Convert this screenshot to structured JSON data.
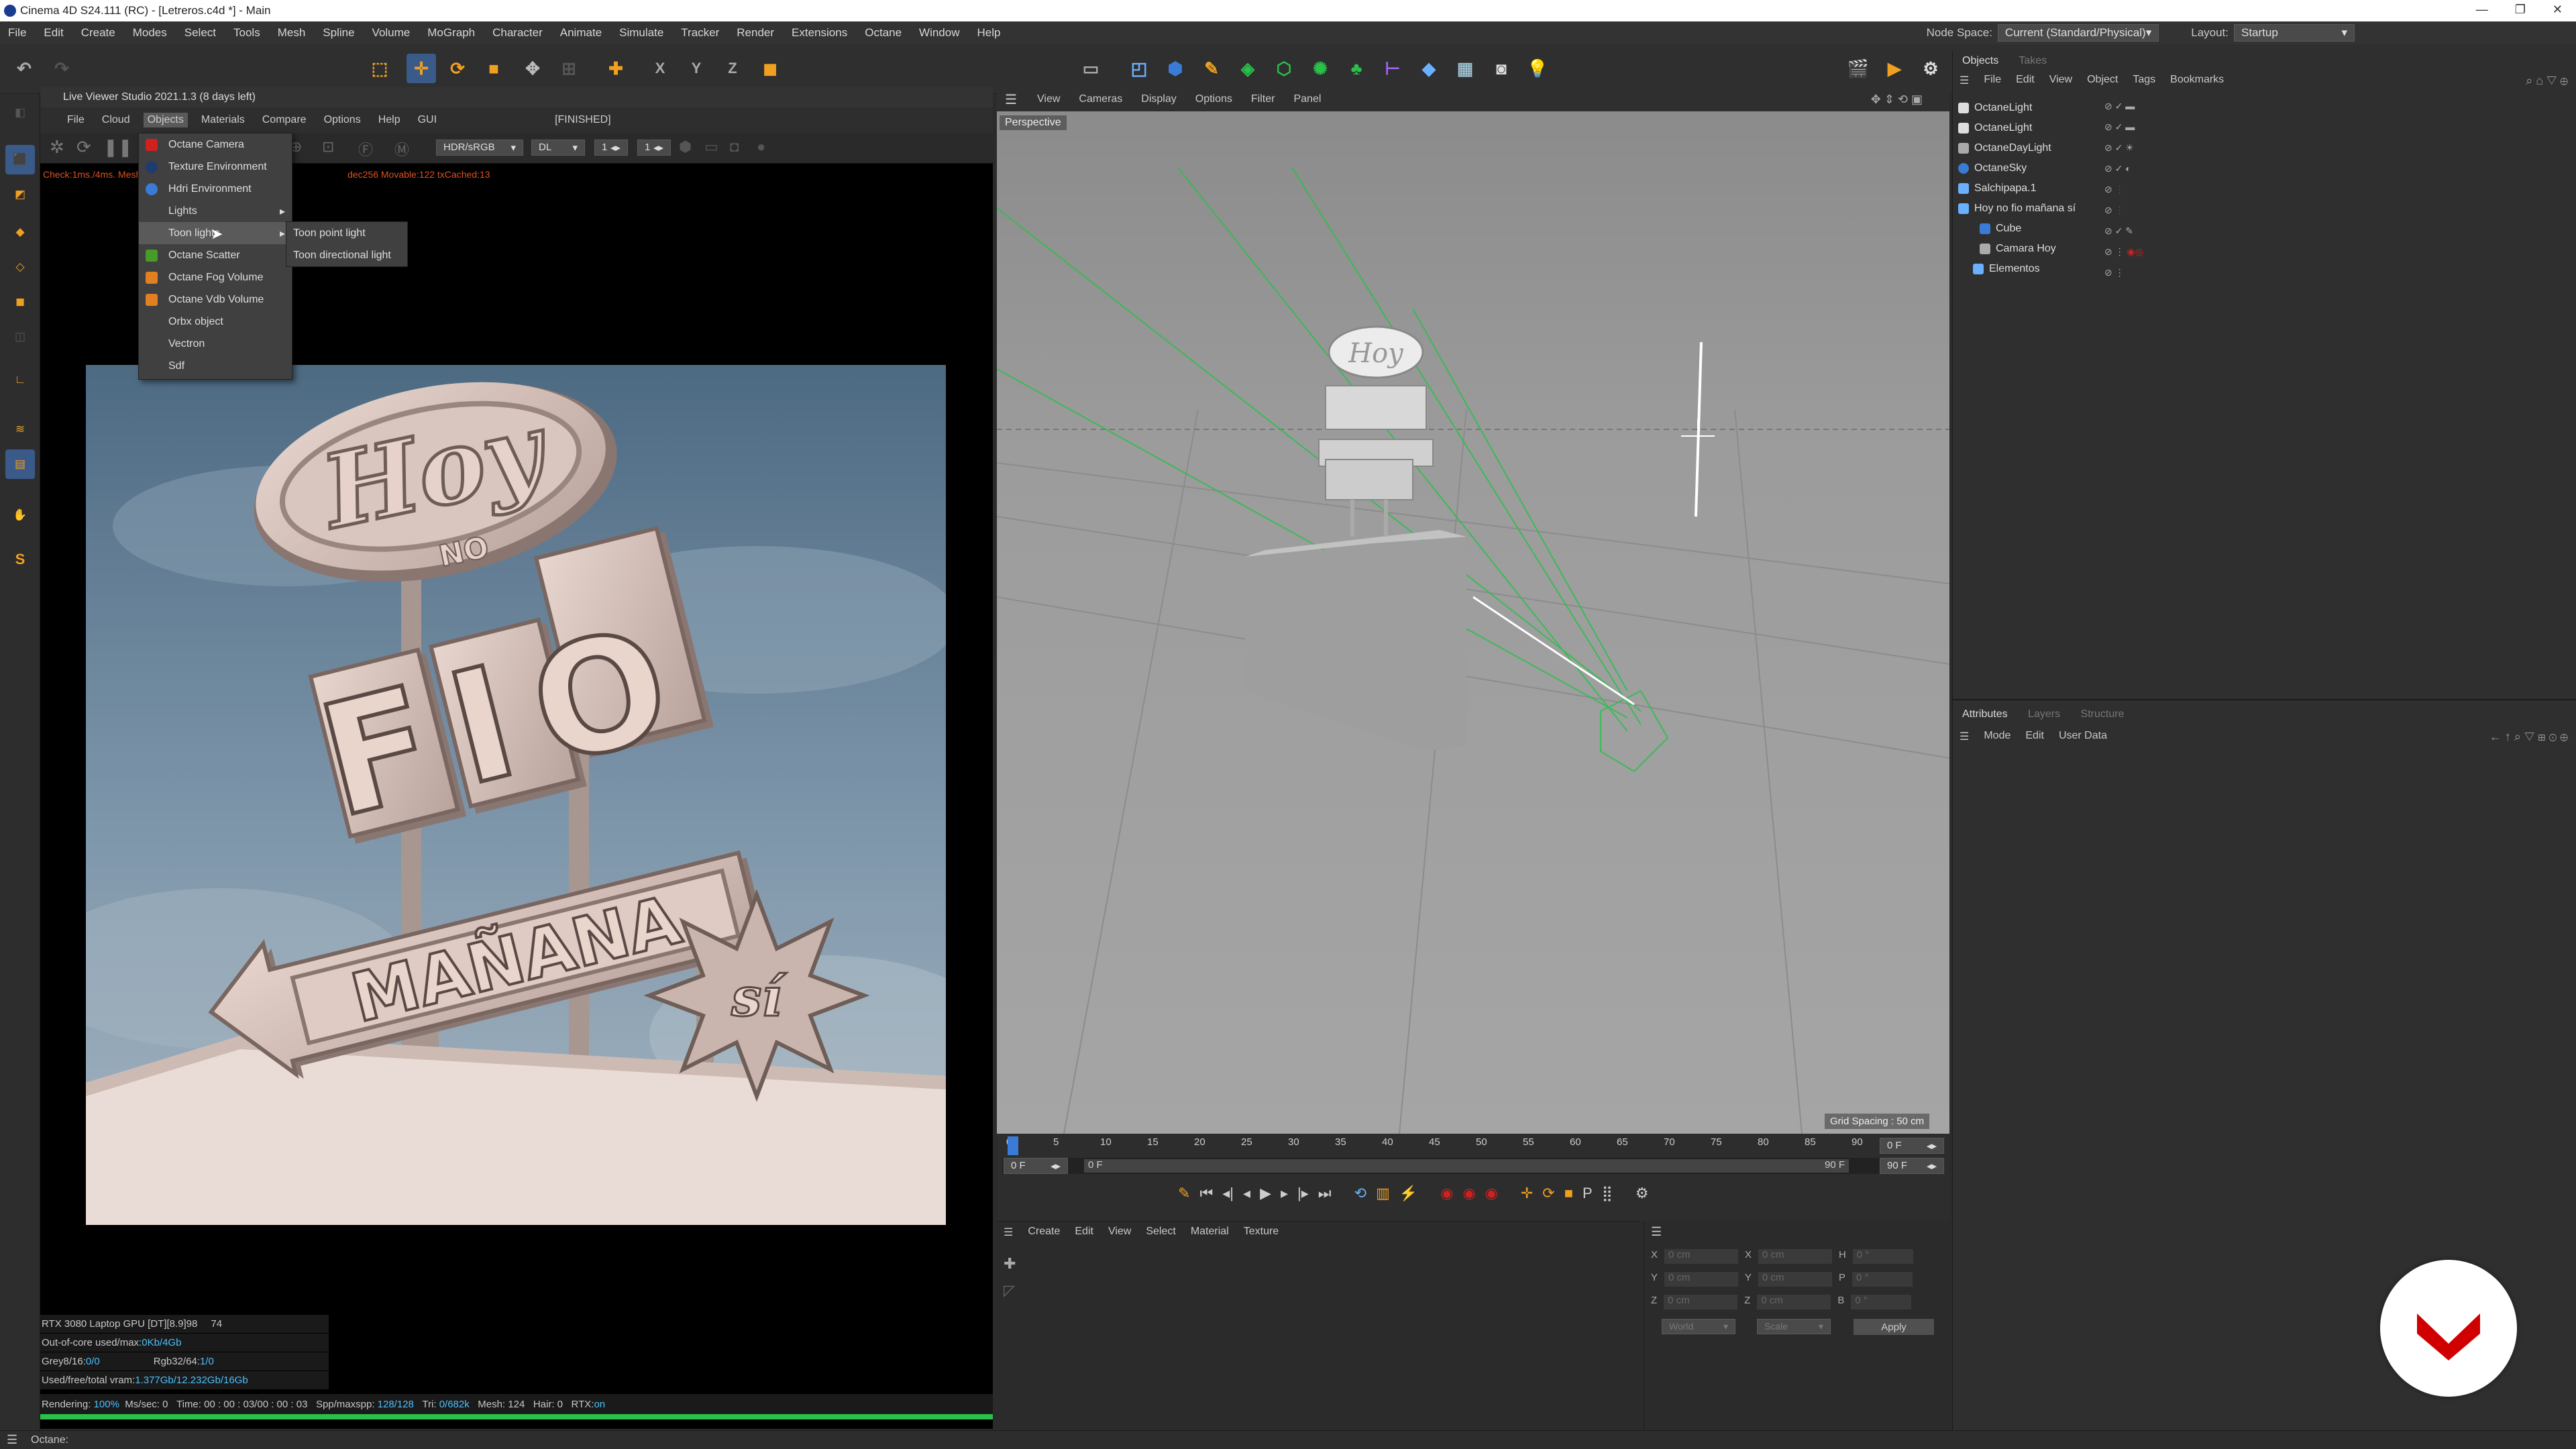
{
  "window": {
    "title": "Cinema 4D S24.111 (RC) - [Letreros.c4d *] - Main",
    "minimize": "—",
    "restore": "❐",
    "close": "✕"
  },
  "menubar": {
    "items": [
      "File",
      "Edit",
      "Create",
      "Modes",
      "Select",
      "Tools",
      "Mesh",
      "Spline",
      "Volume",
      "MoGraph",
      "Character",
      "Animate",
      "Simulate",
      "Tracker",
      "Render",
      "Extensions",
      "Octane",
      "Window",
      "Help"
    ],
    "node_space_label": "Node Space:",
    "node_space_value": "Current (Standard/Physical)",
    "layout_label": "Layout:",
    "layout_value": "Startup"
  },
  "live_viewer": {
    "title": "Live Viewer Studio 2021.1.3 (8 days left)",
    "menu": [
      "File",
      "Cloud",
      "Objects",
      "Materials",
      "Compare",
      "Options",
      "Help",
      "GUI"
    ],
    "status": "[FINISHED]",
    "color_mode": "HDR/sRGB",
    "mode": "DL",
    "val1": "1",
    "val2": "1",
    "info_line": "Check:1ms./4ms. Mesh:",
    "info_line2": "dec256 Movable:122 txCached:13",
    "stats": {
      "gpu": "RTX 3080 Laptop GPU [DT][8.9]98",
      "gpu_val": "74",
      "out_of_core_label": "Out-of-core used/max:",
      "out_of_core_value": "0Kb/4Gb",
      "grey_label": "Grey8/16:",
      "grey_value": "0/0",
      "rgb_label": "Rgb32/64:",
      "rgb_value": "1/0",
      "vram_label": "Used/free/total vram:",
      "vram_value": "1.377Gb/12.232Gb/16Gb"
    },
    "render_line": {
      "rendering": "Rendering:",
      "percent": "100%",
      "mssec": "Ms/sec:",
      "mssec_val": "0",
      "time_label": "Time:",
      "time_val": "00 : 00 : 03/00 : 00 : 03",
      "spp_label": "Spp/maxspp:",
      "spp_val": "128/128",
      "tri_label": "Tri:",
      "tri_val": "0/682k",
      "mesh_label": "Mesh:",
      "mesh_val": "124",
      "hair_label": "Hair:",
      "hair_val": "0",
      "rtx_label": "RTX:",
      "rtx_val": "on"
    },
    "progress": 1.0
  },
  "objects_menu": {
    "items": [
      "Octane Camera",
      "Texture Environment",
      "Hdri Environment",
      "Lights",
      "Toon lights",
      "Octane Scatter",
      "Octane Fog Volume",
      "Octane Vdb Volume",
      "Orbx object",
      "Vectron",
      "Sdf"
    ],
    "submenu": [
      "Toon point light",
      "Toon directional light"
    ]
  },
  "sign": {
    "hoy": "Hoy",
    "no": "NO",
    "fio": "FIO",
    "manana": "MAÑANA",
    "si": "sí"
  },
  "viewport": {
    "menu": [
      "View",
      "Cameras",
      "Display",
      "Options",
      "Filter",
      "Panel"
    ],
    "label": "Perspective",
    "grid_spacing": "Grid Spacing : 50 cm",
    "sign_hoy": "Hoy"
  },
  "timeline": {
    "ticks": [
      "0",
      "5",
      "10",
      "15",
      "20",
      "25",
      "30",
      "35",
      "40",
      "45",
      "50",
      "55",
      "60",
      "65",
      "70",
      "75",
      "80",
      "85",
      "90"
    ],
    "current_frame": "0 F",
    "start": "0 F",
    "range_start": "0 F",
    "range_end": "90 F",
    "end": "90 F"
  },
  "material_manager": {
    "menu": [
      "Create",
      "Edit",
      "View",
      "Select",
      "Material",
      "Texture"
    ]
  },
  "coordinates": {
    "rows": [
      {
        "a": "X",
        "av": "0 cm",
        "b": "X",
        "bv": "0 cm",
        "c": "H",
        "cv": "0 °"
      },
      {
        "a": "Y",
        "av": "0 cm",
        "b": "Y",
        "bv": "0 cm",
        "c": "P",
        "cv": "0 °"
      },
      {
        "a": "Z",
        "av": "0 cm",
        "b": "Z",
        "bv": "0 cm",
        "c": "B",
        "cv": "0 °"
      }
    ],
    "world": "World",
    "scale": "Scale",
    "apply": "Apply"
  },
  "objects_panel": {
    "tabs": [
      "Objects",
      "Takes"
    ],
    "menu": [
      "File",
      "Edit",
      "View",
      "Object",
      "Tags",
      "Bookmarks"
    ],
    "items": [
      "OctaneLight",
      "OctaneLight",
      "OctaneDayLight",
      "OctaneSky",
      "Salchipapa.1",
      "Hoy no fio mañana sí",
      "Cube",
      "Camara Hoy",
      "Elementos"
    ]
  },
  "attributes_panel": {
    "tabs": [
      "Attributes",
      "Layers",
      "Structure"
    ],
    "menu": [
      "Mode",
      "Edit",
      "User Data"
    ]
  },
  "statusbar": {
    "text": "Octane:"
  },
  "colors": {
    "accent": "#f0a020",
    "blue": "#3a7bd5",
    "green": "#2ac04a",
    "brand": "#d10000"
  }
}
